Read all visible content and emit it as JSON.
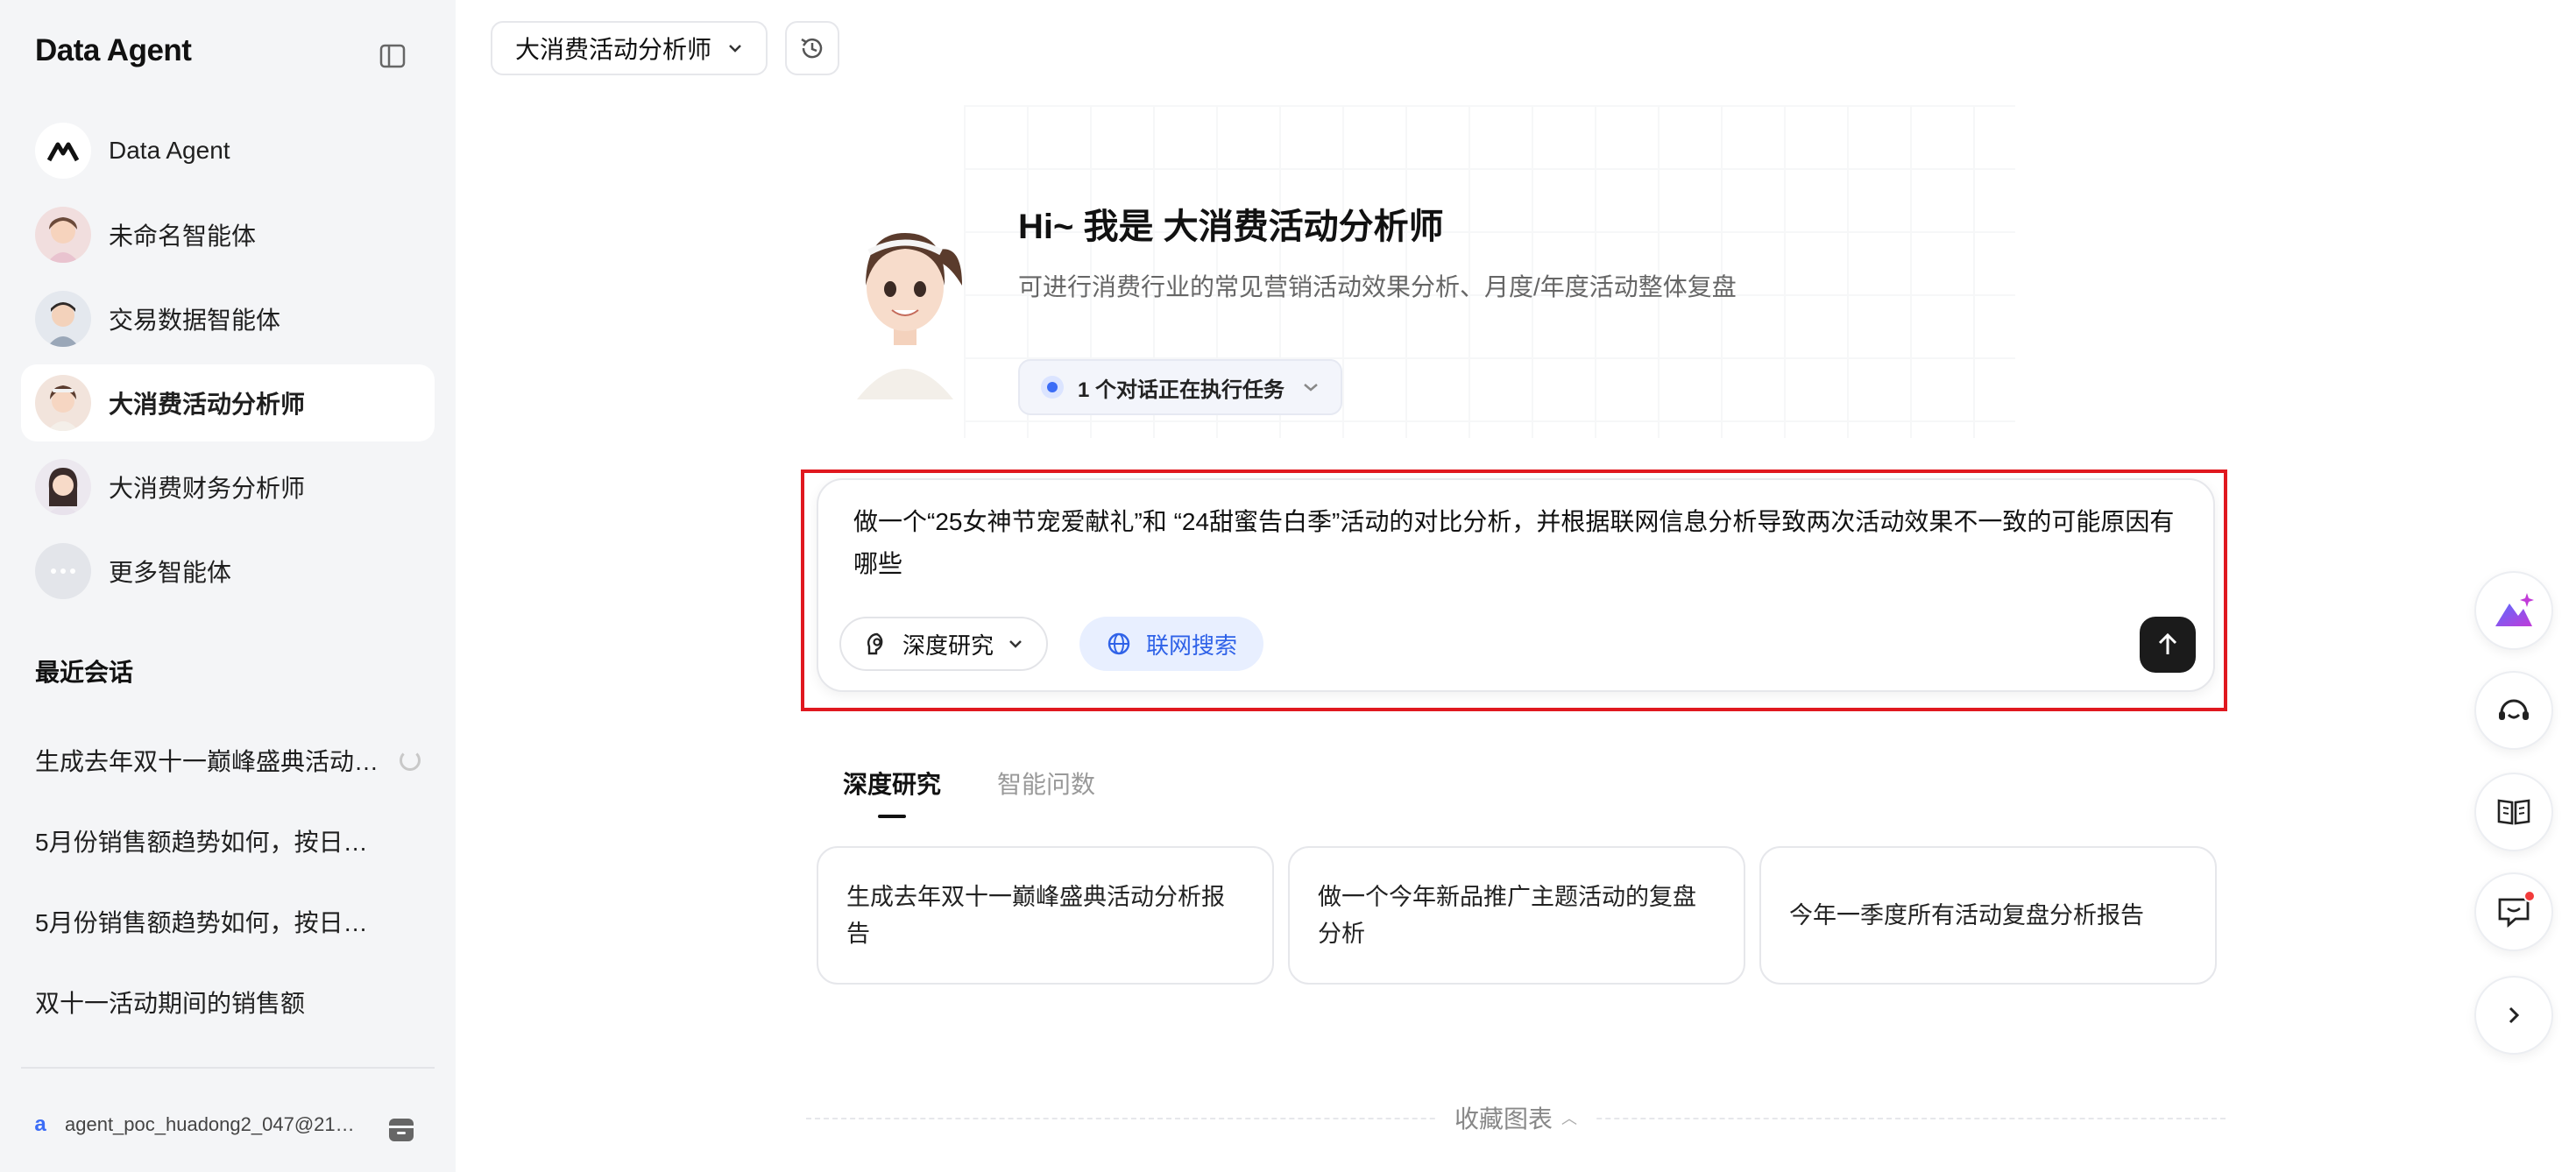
{
  "sidebar": {
    "brand": "Data Agent",
    "agents": [
      {
        "label": "Data Agent",
        "icon": "data-agent-logo-icon"
      },
      {
        "label": "未命名智能体",
        "icon": "female-avatar-icon"
      },
      {
        "label": "交易数据智能体",
        "icon": "male-avatar-icon"
      },
      {
        "label": "大消费活动分析师",
        "icon": "female-avatar-icon",
        "active": true
      },
      {
        "label": "大消费财务分析师",
        "icon": "female-avatar-icon"
      },
      {
        "label": "更多智能体",
        "icon": "more-dots-icon"
      }
    ],
    "recent_title": "最近会话",
    "recent": [
      {
        "label": "生成去年双十一巅峰盛典活动…",
        "loading": true
      },
      {
        "label": "5月份销售额趋势如何，按日…"
      },
      {
        "label": "5月份销售额趋势如何，按日…"
      },
      {
        "label": "双十一活动期间的销售额"
      }
    ],
    "user": {
      "initial": "a",
      "name": "agent_poc_huadong2_047@2101..."
    }
  },
  "header": {
    "agent_select": "大消费活动分析师"
  },
  "hero": {
    "title": "Hi~ 我是 大消费活动分析师",
    "subtitle": "可进行消费行业的常见营销活动效果分析、月度/年度活动整体复盘",
    "task_status": "1 个对话正在执行任务"
  },
  "composer": {
    "text": "做一个“25女神节宠爱献礼”和 “24甜蜜告白季”活动的对比分析，并根据联网信息分析导致两次活动效果不一致的可能原因有哪些",
    "mode": "深度研究",
    "web_search": "联网搜索"
  },
  "tabs": [
    {
      "label": "深度研究",
      "active": true
    },
    {
      "label": "智能问数",
      "active": false
    }
  ],
  "suggestions": [
    "生成去年双十一巅峰盛典活动分析报告",
    "做一个今年新品推广主题活动的复盘分析",
    "今年一季度所有活动复盘分析报告"
  ],
  "favorites_label": "收藏图表",
  "colors": {
    "accent": "#3b6cf6",
    "highlight": "#e0181f",
    "send": "#1b1b1b"
  }
}
